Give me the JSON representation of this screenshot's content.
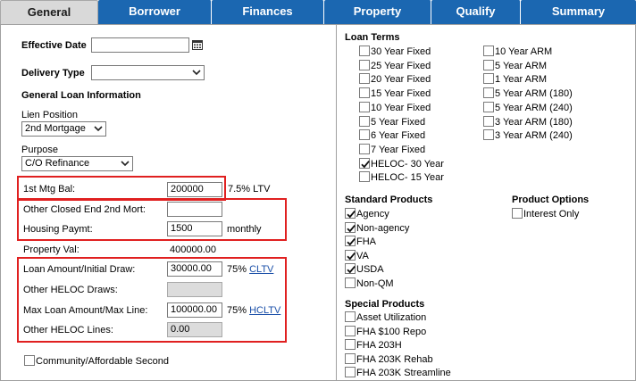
{
  "tabs": [
    {
      "label": "General",
      "active": true
    },
    {
      "label": "Borrower",
      "active": false
    },
    {
      "label": "Finances",
      "active": false
    },
    {
      "label": "Property",
      "active": false
    },
    {
      "label": "Qualify",
      "active": false
    },
    {
      "label": "Summary",
      "active": false
    }
  ],
  "left": {
    "effective_date_label": "Effective Date",
    "effective_date_value": "",
    "delivery_type_label": "Delivery Type",
    "delivery_type_value": "",
    "general_loan_info_heading": "General Loan Information",
    "lien_position_label": "Lien Position",
    "lien_position_value": "2nd Mortgage",
    "purpose_label": "Purpose",
    "purpose_value": "C/O Refinance",
    "first_mtg_bal_label": "1st Mtg Bal:",
    "first_mtg_bal_value": "200000",
    "ltv_text": "7.5% LTV",
    "other_closed_end_label": "Other Closed End 2nd Mort:",
    "other_closed_end_value": "",
    "housing_paymt_label": "Housing Paymt:",
    "housing_paymt_value": "1500",
    "housing_paymt_unit": "monthly",
    "property_val_label": "Property Val:",
    "property_val_value": "400000.00",
    "loan_amount_label": "Loan Amount/Initial Draw:",
    "loan_amount_value": "30000.00",
    "cltv_pct": "75%",
    "cltv_link": "CLTV",
    "other_heloc_draws_label": "Other HELOC Draws:",
    "other_heloc_draws_value": "",
    "max_loan_label": "Max Loan Amount/Max Line:",
    "max_loan_value": "100000.00",
    "hcltv_pct": "75%",
    "hcltv_link": "HCLTV",
    "other_heloc_lines_label": "Other HELOC Lines:",
    "other_heloc_lines_value": "0.00",
    "community_label": "Community/Affordable Second"
  },
  "loan_terms": {
    "heading": "Loan Terms",
    "col1": [
      {
        "label": "30 Year Fixed",
        "checked": false
      },
      {
        "label": "25 Year Fixed",
        "checked": false
      },
      {
        "label": "20 Year Fixed",
        "checked": false
      },
      {
        "label": "15 Year Fixed",
        "checked": false
      },
      {
        "label": "10 Year Fixed",
        "checked": false
      },
      {
        "label": "5 Year Fixed",
        "checked": false
      },
      {
        "label": "6 Year Fixed",
        "checked": false
      },
      {
        "label": "7 Year Fixed",
        "checked": false
      },
      {
        "label": "HELOC- 30 Year",
        "checked": true
      },
      {
        "label": "HELOC- 15 Year",
        "checked": false
      }
    ],
    "col2": [
      {
        "label": "10 Year ARM",
        "checked": false
      },
      {
        "label": "5 Year ARM",
        "checked": false
      },
      {
        "label": "1 Year ARM",
        "checked": false
      },
      {
        "label": "5 Year ARM (180)",
        "checked": false
      },
      {
        "label": "5 Year ARM (240)",
        "checked": false
      },
      {
        "label": "3 Year ARM (180)",
        "checked": false
      },
      {
        "label": "3 Year ARM (240)",
        "checked": false
      }
    ]
  },
  "standard_products": {
    "heading": "Standard Products",
    "items": [
      {
        "label": "Agency",
        "checked": true
      },
      {
        "label": "Non-agency",
        "checked": true
      },
      {
        "label": "FHA",
        "checked": true
      },
      {
        "label": "VA",
        "checked": true
      },
      {
        "label": "USDA",
        "checked": true
      },
      {
        "label": "Non-QM",
        "checked": false
      }
    ]
  },
  "product_options": {
    "heading": "Product Options",
    "items": [
      {
        "label": "Interest Only",
        "checked": false
      }
    ]
  },
  "special_products": {
    "heading": "Special Products",
    "items": [
      {
        "label": "Asset Utilization",
        "checked": false
      },
      {
        "label": "FHA $100 Repo",
        "checked": false
      },
      {
        "label": "FHA 203H",
        "checked": false
      },
      {
        "label": "FHA 203K Rehab",
        "checked": false
      },
      {
        "label": "FHA 203K Streamline",
        "checked": false
      }
    ]
  },
  "colors": {
    "tab_blue": "#1b67b1",
    "tab_active": "#d9d9d9",
    "highlight_red": "#e02020",
    "link": "#1a4fa8"
  }
}
